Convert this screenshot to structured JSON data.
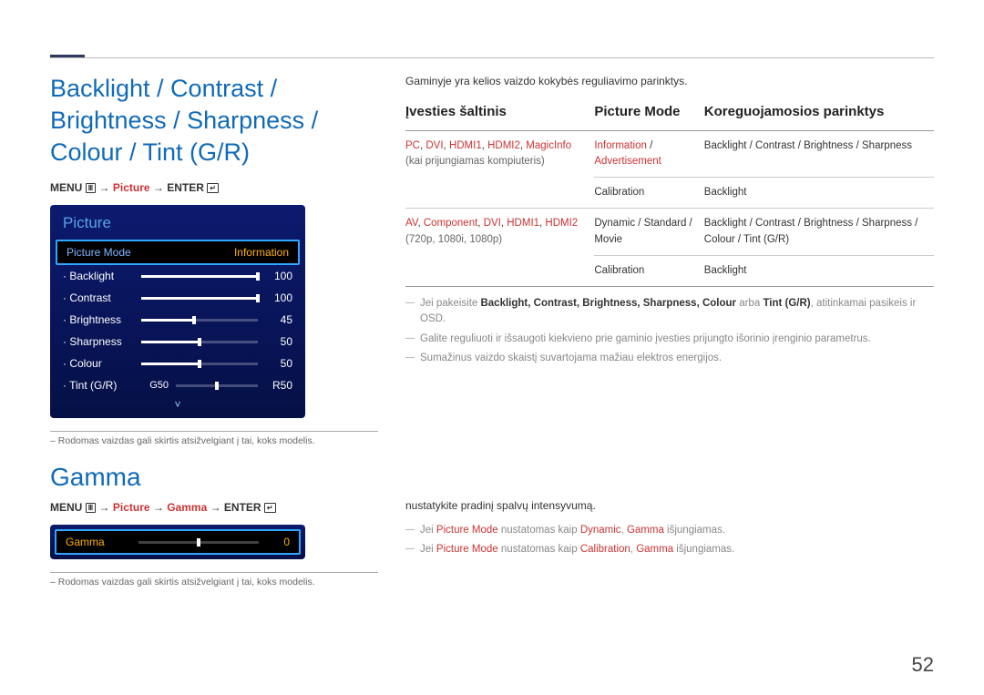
{
  "page_number": "52",
  "heading1": "Backlight / Contrast / Brightness / Sharpness / Colour / Tint (G/R)",
  "heading2": "Gamma",
  "menupath1": {
    "p1": "MENU ",
    "icon1": "Ⅲ",
    "p2": " → ",
    "accent": "Picture",
    "p3": " → ENTER ",
    "icon2": "↵"
  },
  "menupath2": {
    "p1": "MENU ",
    "icon1": "Ⅲ",
    "p2": " → ",
    "a1": "Picture",
    "p3": " → ",
    "a2": "Gamma",
    "p4": " → ENTER ",
    "icon2": "↵"
  },
  "osd": {
    "title": "Picture",
    "hilite_left": "Picture Mode",
    "hilite_right": "Information",
    "rows": [
      {
        "label": "Backlight",
        "value": "100",
        "pct": 100
      },
      {
        "label": "Contrast",
        "value": "100",
        "pct": 100
      },
      {
        "label": "Brightness",
        "value": "45",
        "pct": 45
      },
      {
        "label": "Sharpness",
        "value": "50",
        "pct": 50
      },
      {
        "label": "Colour",
        "value": "50",
        "pct": 50
      },
      {
        "label": "Tint (G/R)",
        "gval": "G50",
        "value": "R50",
        "tint": true
      }
    ],
    "chev": "˅"
  },
  "gamma_osd": {
    "label": "Gamma",
    "value": "0"
  },
  "note_text": "Rodomas vaizdas gali skirtis atsižvelgiant į tai, koks modelis.",
  "intro_right": "Gaminyje yra kelios vaizdo kokybės reguliavimo parinktys.",
  "table": {
    "h1": "Įvesties šaltinis",
    "h2": "Picture Mode",
    "h3": "Koreguojamosios parinktys",
    "rows": [
      {
        "c1a": "PC",
        "c1b": ", ",
        "c1c": "DVI",
        "c1d": ", ",
        "c1e": "HDMI1",
        "c1f": ", ",
        "c1g": "HDMI2",
        "c1h": ", ",
        "c1i": "MagicInfo",
        "c1_sub": "(kai prijungiamas kompiuteris)",
        "c2a": "Information",
        "c2b": " / ",
        "c2c": "Advertisement",
        "c3": "Backlight / Contrast / Brightness / Sharpness"
      },
      {
        "c2": "Calibration",
        "c3": "Backlight"
      },
      {
        "c1a": "AV",
        "c1b": ", ",
        "c1c": "Component",
        "c1d": ", ",
        "c1e": "DVI",
        "c1f": ", ",
        "c1g": "HDMI1",
        "c1h": ", ",
        "c1i": "HDMI2",
        "c1_sub": " (720p, 1080i, 1080p)",
        "c2": "Dynamic / Standard / Movie",
        "c3": "Backlight / Contrast / Brightness / Sharpness / Colour / Tint (G/R)"
      },
      {
        "c2": "Calibration",
        "c3": "Backlight"
      }
    ]
  },
  "right_notes": [
    {
      "pre": "Jei pakeisite ",
      "b": "Backlight, Contrast, Brightness, Sharpness, Colour",
      "mid": " arba ",
      "b2": "Tint (G/R)",
      "post": ", atitinkamai pasikeis ir OSD."
    },
    {
      "text": "Galite reguliuoti ir išsaugoti kiekvieno prie gaminio įvesties prijungto išorinio įrenginio parametrus."
    },
    {
      "text": "Sumažinus vaizdo skaistį suvartojama mažiau elektros energijos."
    }
  ],
  "gamma_intro": "nustatykite pradinį spalvų intensyvumą.",
  "gamma_notes": [
    {
      "p1": "Jei ",
      "a1": "Picture Mode",
      "p2": " nustatomas kaip ",
      "a2": "Dynamic",
      "p3": ", ",
      "a3": "Gamma",
      "p4": " išjungiamas."
    },
    {
      "p1": "Jei ",
      "a1": "Picture Mode",
      "p2": " nustatomas kaip ",
      "a2": "Calibration",
      "p3": ", ",
      "a3": "Gamma",
      "p4": " išjungiamas."
    }
  ]
}
